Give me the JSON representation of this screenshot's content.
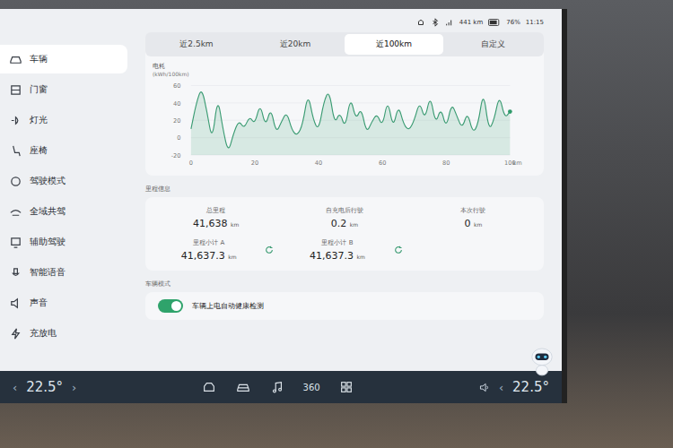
{
  "status_bar": {
    "range": "441 km",
    "battery": "76%",
    "time": "11:15"
  },
  "sidebar": {
    "items": [
      {
        "label": "车辆",
        "selected": true
      },
      {
        "label": "门窗",
        "selected": false
      },
      {
        "label": "灯光",
        "selected": false
      },
      {
        "label": "座椅",
        "selected": false
      },
      {
        "label": "驾驶模式",
        "selected": false
      },
      {
        "label": "全域共驾",
        "selected": false
      },
      {
        "label": "辅助驾驶",
        "selected": false
      },
      {
        "label": "智能语音",
        "selected": false
      },
      {
        "label": "声音",
        "selected": false
      },
      {
        "label": "充放电",
        "selected": false
      }
    ]
  },
  "tabs": [
    {
      "label": "近2.5km",
      "selected": false
    },
    {
      "label": "近20km",
      "selected": false
    },
    {
      "label": "近100km",
      "selected": true
    },
    {
      "label": "自定义",
      "selected": false
    }
  ],
  "chart": {
    "title": "电耗",
    "unit": "(kWh/100km)",
    "y_ticks": [
      "60",
      "40",
      "20",
      "0",
      "-20"
    ],
    "x_ticks": [
      "0",
      "20",
      "40",
      "60",
      "80",
      "100"
    ],
    "x_unit": "km",
    "series": [
      {
        "name": "电耗",
        "values": [
          10,
          40,
          58,
          30,
          -5,
          48,
          10,
          -18,
          5,
          20,
          10,
          25,
          15,
          40,
          12,
          35,
          5,
          18,
          30,
          8,
          2,
          15,
          52,
          20,
          8,
          42,
          55,
          15,
          30,
          10,
          48,
          20,
          35,
          5,
          18,
          28,
          12,
          45,
          10,
          38,
          15,
          8,
          20,
          42,
          20,
          50,
          15,
          35,
          10,
          40,
          25,
          10,
          30,
          5,
          15,
          55,
          8,
          20,
          50,
          22,
          30
        ]
      }
    ]
  },
  "mileage": {
    "title": "里程信息",
    "cells": [
      {
        "label": "总里程",
        "value": "41,638",
        "unit": "km",
        "resettable": false
      },
      {
        "label": "自充电后行驶",
        "value": "0.2",
        "unit": "km",
        "resettable": false
      },
      {
        "label": "本次行驶",
        "value": "0",
        "unit": "km",
        "resettable": false
      },
      {
        "label": "里程小计 A",
        "value": "41,637.3",
        "unit": "km",
        "resettable": true
      },
      {
        "label": "里程小计 B",
        "value": "41,637.3",
        "unit": "km",
        "resettable": true
      }
    ]
  },
  "vehicle_mode": {
    "title": "车辆模式",
    "toggle": {
      "label": "车辆上电自动健康检测",
      "on": true
    }
  },
  "dock": {
    "items": [
      {
        "kind": "home"
      },
      {
        "kind": "car"
      },
      {
        "kind": "music"
      },
      {
        "kind": "view360",
        "label": "360"
      },
      {
        "kind": "apps"
      }
    ]
  },
  "climate": {
    "left": {
      "temp": "22.5°",
      "dec": "‹",
      "inc": "›"
    },
    "right": {
      "temp": "22.5°",
      "dec": "‹"
    }
  }
}
